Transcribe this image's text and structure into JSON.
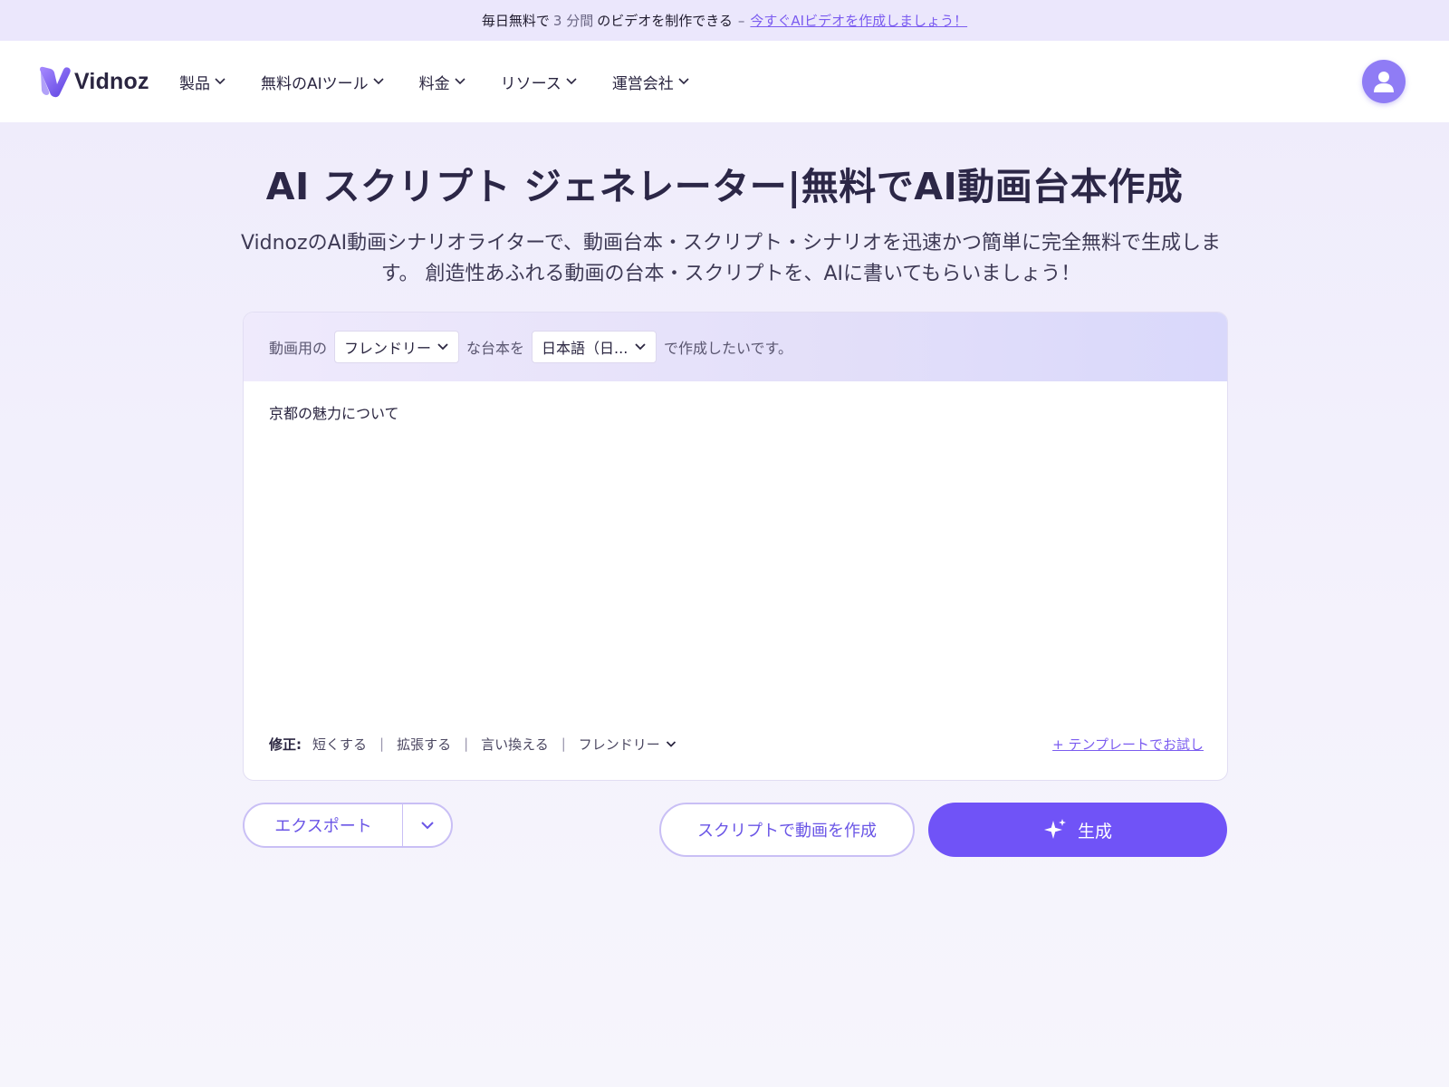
{
  "banner": {
    "prefix": "毎日無料で",
    "number": "3 分間",
    "suffix": "のビデオを制作できる",
    "dash": "–",
    "link": "今すぐAIビデオを作成しましょう！"
  },
  "header": {
    "logo_text": "Vidnoz",
    "nav": [
      {
        "label": "製品"
      },
      {
        "label": "無料のAIツール"
      },
      {
        "label": "料金"
      },
      {
        "label": "リソース"
      },
      {
        "label": "運営会社"
      }
    ]
  },
  "hero": {
    "title": "AI スクリプト ジェネレーター|無料でAI動画台本作成",
    "subtitle": "VidnozのAI動画シナリオライターで、動画台本・スクリプト・シナリオを迅速かつ簡単に完全無料で生成します。 創造性あふれる動画の台本・スクリプトを、AIに書いてもらいましょう！"
  },
  "editor": {
    "prefix": "動画用の",
    "tone_selected": "フレンドリー",
    "middle": "な台本を",
    "lang_selected": "日本語（日...",
    "suffix": "で作成したいです。",
    "input_value": "京都の魅力について",
    "modify_label": "修正:",
    "actions": [
      "短くする",
      "拡張する",
      "言い換える"
    ],
    "tone_action": "フレンドリー",
    "template_link": "+ テンプレートでお試し"
  },
  "buttons": {
    "export": "エクスポート",
    "create_video": "スクリプトで動画を作成",
    "generate": "生成"
  },
  "colors": {
    "accent": "#7053f7",
    "link": "#7b5cf0",
    "banner_bg": "#ebe7fc"
  }
}
